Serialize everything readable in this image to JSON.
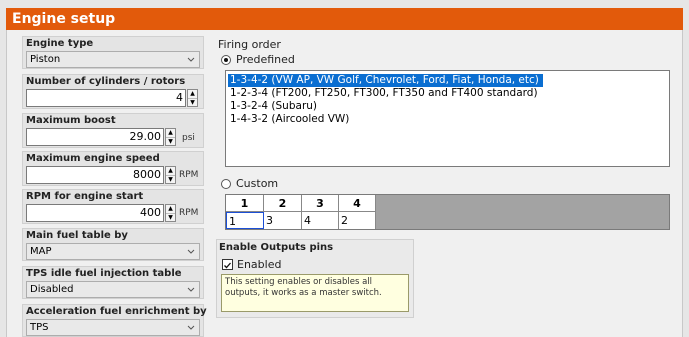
{
  "window": {
    "title": "Engine setup",
    "accent": "#e25a0b"
  },
  "engine_type": {
    "label": "Engine type",
    "value": "Piston"
  },
  "cylinders": {
    "label": "Number of cylinders / rotors",
    "value": "4"
  },
  "max_boost": {
    "label": "Maximum boost",
    "value": "29.00",
    "unit": "psi"
  },
  "max_speed": {
    "label": "Maximum engine speed",
    "value": "8000",
    "unit": "RPM"
  },
  "rpm_start": {
    "label": "RPM for engine start",
    "value": "400",
    "unit": "RPM"
  },
  "main_fuel": {
    "label": "Main fuel table by",
    "value": "MAP"
  },
  "tps_idle": {
    "label": "TPS idle fuel injection table",
    "value": "Disabled"
  },
  "accel_fuel": {
    "label": "Acceleration fuel enrichment by",
    "value": "TPS"
  },
  "firing_order": {
    "title": "Firing order",
    "predefined_label": "Predefined",
    "custom_label": "Custom",
    "selected_mode": "Predefined",
    "options": [
      "1-3-4-2 (VW AP, VW Golf, Chevrolet, Ford, Fiat, Honda, etc)",
      "1-2-3-4 (FT200, FT250, FT300, FT350 and FT400 standard)",
      "1-3-2-4 (Subaru)",
      "1-4-3-2 (Aircooled VW)"
    ],
    "selected_index": 0,
    "custom_grid": {
      "headers": [
        "1",
        "2",
        "3",
        "4"
      ],
      "values": [
        "1",
        "3",
        "4",
        "2"
      ]
    }
  },
  "outputs": {
    "title": "Enable Outputs pins",
    "checkbox_label": "Enabled",
    "checked": true,
    "help": "This setting enables or disables all outputs, it works as a master switch."
  }
}
